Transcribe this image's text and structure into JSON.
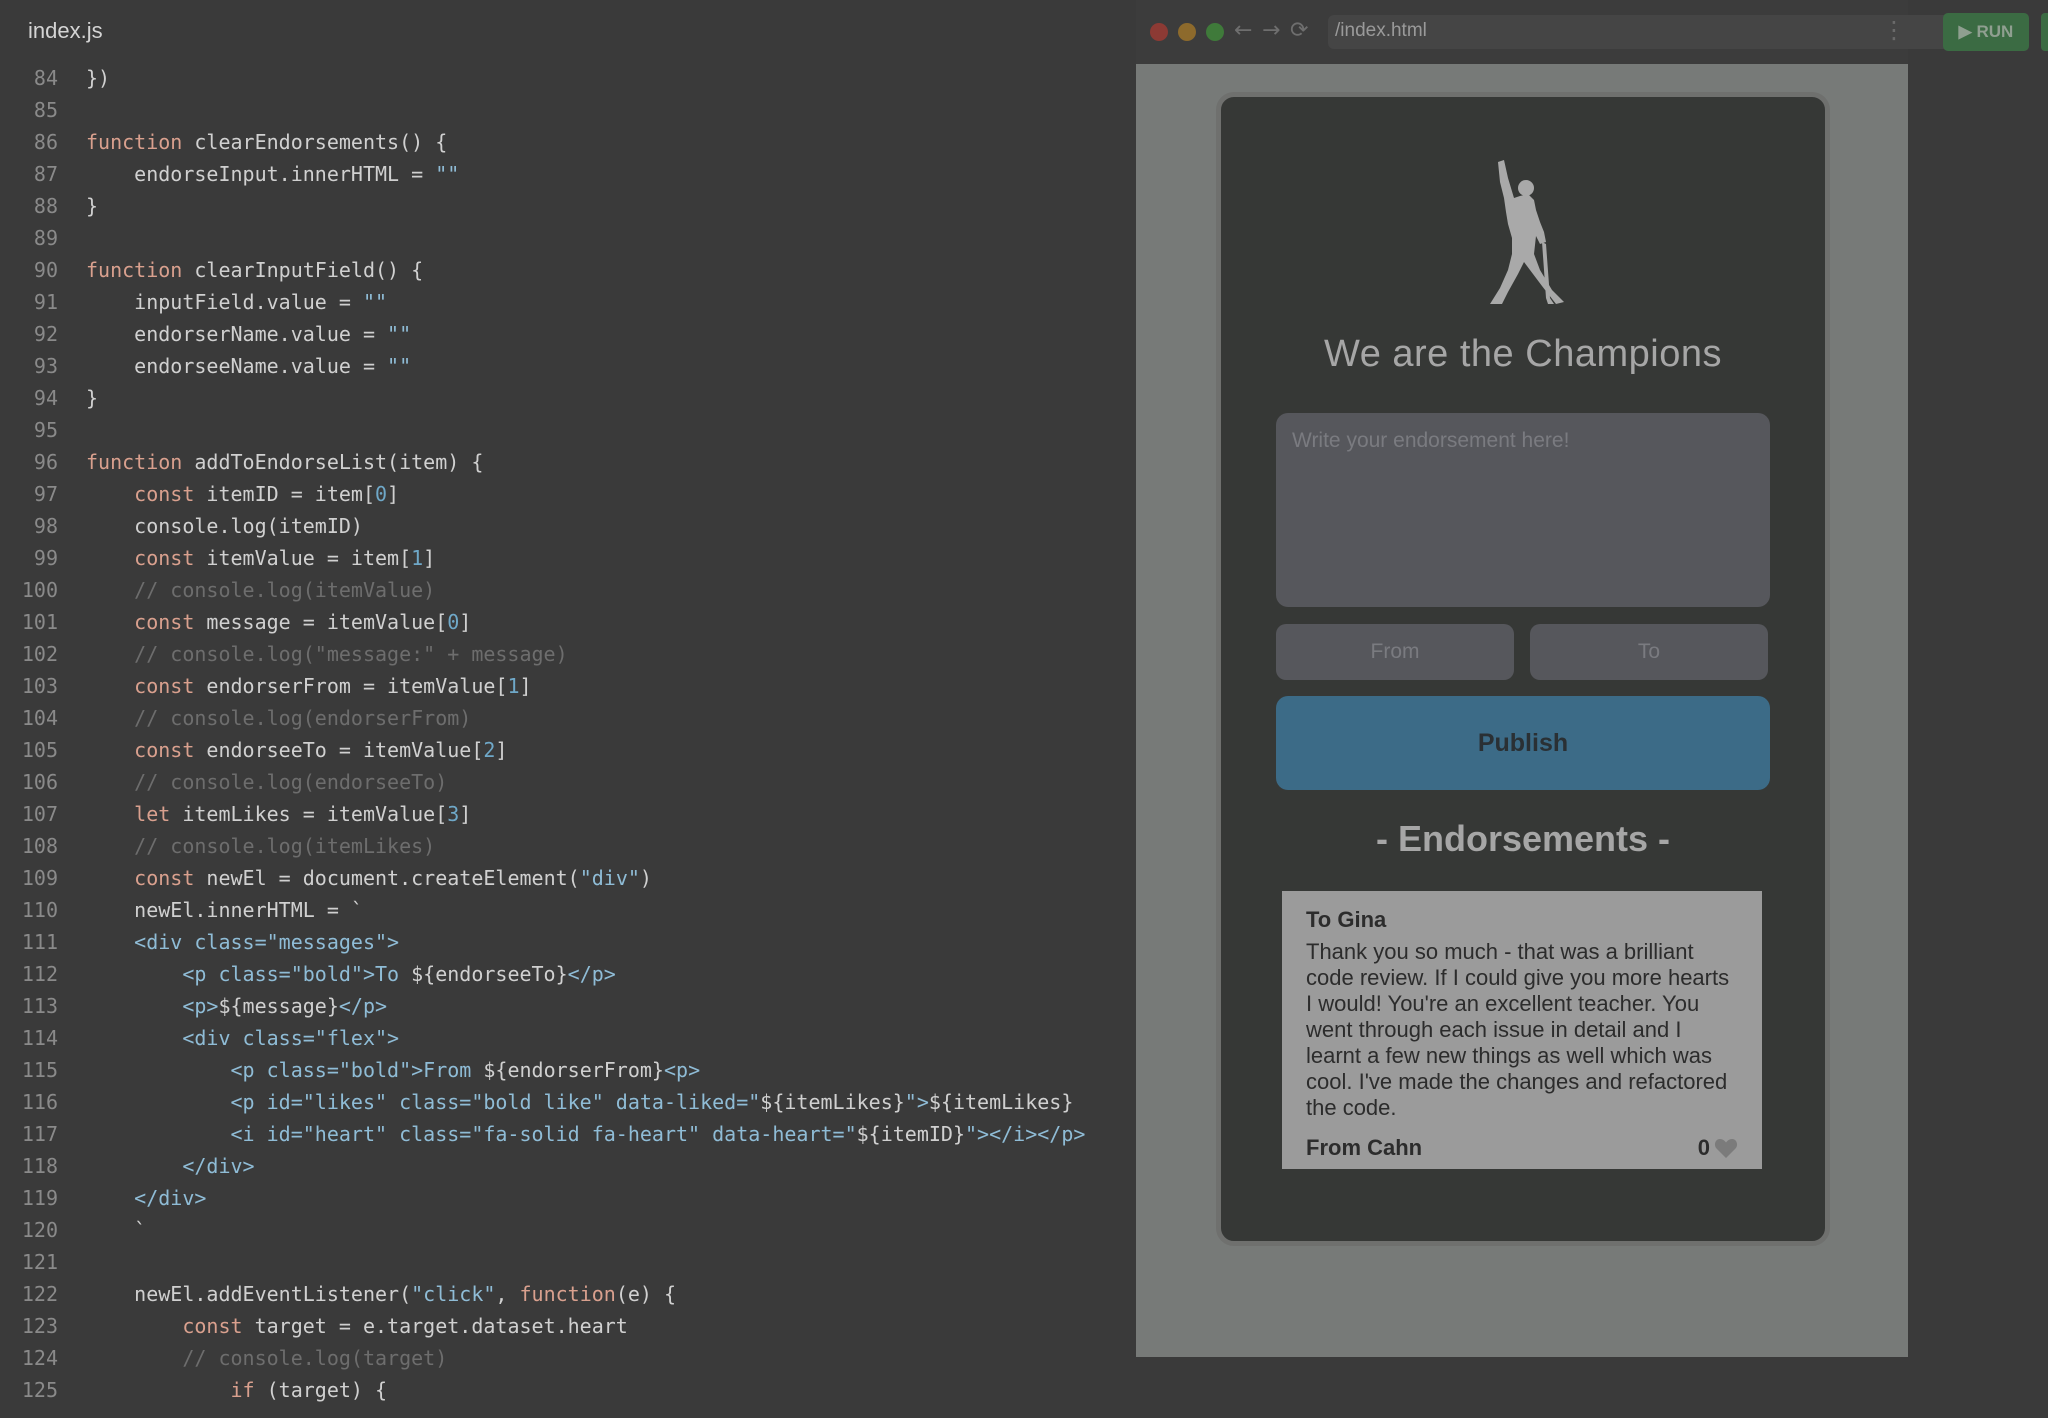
{
  "editor": {
    "tab_title": "index.js",
    "lines": [
      {
        "n": "84",
        "t": [
          [
            "})",
            "pl"
          ]
        ]
      },
      {
        "n": "85",
        "t": []
      },
      {
        "n": "86",
        "t": [
          [
            "function ",
            "kw"
          ],
          [
            "clearEndorsements() {",
            "pl"
          ]
        ]
      },
      {
        "n": "87",
        "t": [
          [
            "    endorseInput.innerHTML = ",
            "pl"
          ],
          [
            "\"\"",
            "str"
          ]
        ]
      },
      {
        "n": "88",
        "t": [
          [
            "}",
            "pl"
          ]
        ]
      },
      {
        "n": "89",
        "t": []
      },
      {
        "n": "90",
        "t": [
          [
            "function ",
            "kw"
          ],
          [
            "clearInputField() {",
            "pl"
          ]
        ]
      },
      {
        "n": "91",
        "t": [
          [
            "    inputField.value = ",
            "pl"
          ],
          [
            "\"\"",
            "str"
          ]
        ]
      },
      {
        "n": "92",
        "t": [
          [
            "    endorserName.value = ",
            "pl"
          ],
          [
            "\"\"",
            "str"
          ]
        ]
      },
      {
        "n": "93",
        "t": [
          [
            "    endorseeName.value = ",
            "pl"
          ],
          [
            "\"\"",
            "str"
          ]
        ]
      },
      {
        "n": "94",
        "t": [
          [
            "}",
            "pl"
          ]
        ]
      },
      {
        "n": "95",
        "t": []
      },
      {
        "n": "96",
        "t": [
          [
            "function ",
            "kw"
          ],
          [
            "addToEndorseList(item) {",
            "pl"
          ]
        ]
      },
      {
        "n": "97",
        "t": [
          [
            "    const ",
            "kw"
          ],
          [
            "itemID = item[",
            "pl"
          ],
          [
            "0",
            "num"
          ],
          [
            "]",
            "pl"
          ]
        ]
      },
      {
        "n": "98",
        "t": [
          [
            "    console.log(itemID)",
            "pl"
          ]
        ]
      },
      {
        "n": "99",
        "t": [
          [
            "    const ",
            "kw"
          ],
          [
            "itemValue = item[",
            "pl"
          ],
          [
            "1",
            "num"
          ],
          [
            "]",
            "pl"
          ]
        ]
      },
      {
        "n": "100",
        "t": [
          [
            "    // console.log(itemValue)",
            "cm"
          ]
        ]
      },
      {
        "n": "101",
        "t": [
          [
            "    const ",
            "kw"
          ],
          [
            "message = itemValue[",
            "pl"
          ],
          [
            "0",
            "num"
          ],
          [
            "]",
            "pl"
          ]
        ]
      },
      {
        "n": "102",
        "t": [
          [
            "    // console.log(\"message:\" + message)",
            "cm"
          ]
        ]
      },
      {
        "n": "103",
        "t": [
          [
            "    const ",
            "kw"
          ],
          [
            "endorserFrom = itemValue[",
            "pl"
          ],
          [
            "1",
            "num"
          ],
          [
            "]",
            "pl"
          ]
        ]
      },
      {
        "n": "104",
        "t": [
          [
            "    // console.log(endorserFrom)",
            "cm"
          ]
        ]
      },
      {
        "n": "105",
        "t": [
          [
            "    const ",
            "kw"
          ],
          [
            "endorseeTo = itemValue[",
            "pl"
          ],
          [
            "2",
            "num"
          ],
          [
            "]",
            "pl"
          ]
        ]
      },
      {
        "n": "106",
        "t": [
          [
            "    // console.log(endorseeTo)",
            "cm"
          ]
        ]
      },
      {
        "n": "107",
        "t": [
          [
            "    let ",
            "kw"
          ],
          [
            "itemLikes = itemValue[",
            "pl"
          ],
          [
            "3",
            "num"
          ],
          [
            "]",
            "pl"
          ]
        ]
      },
      {
        "n": "108",
        "t": [
          [
            "    // console.log(itemLikes)",
            "cm"
          ]
        ]
      },
      {
        "n": "109",
        "t": [
          [
            "    const ",
            "kw"
          ],
          [
            "newEl = document.createElement(",
            "pl"
          ],
          [
            "\"div\"",
            "str"
          ],
          [
            ")",
            "pl"
          ]
        ]
      },
      {
        "n": "110",
        "t": [
          [
            "    newEl.innerHTML = `",
            "pl"
          ]
        ]
      },
      {
        "n": "111",
        "t": [
          [
            "    <div class=\"messages\">",
            "tag"
          ]
        ]
      },
      {
        "n": "112",
        "t": [
          [
            "        <p class=\"bold\">To ",
            "tag"
          ],
          [
            "${endorseeTo}",
            "pl"
          ],
          [
            "</p>",
            "tag"
          ]
        ]
      },
      {
        "n": "113",
        "t": [
          [
            "        <p>",
            "tag"
          ],
          [
            "${message}",
            "pl"
          ],
          [
            "</p>",
            "tag"
          ]
        ]
      },
      {
        "n": "114",
        "t": [
          [
            "        <div class=\"flex\">",
            "tag"
          ]
        ]
      },
      {
        "n": "115",
        "t": [
          [
            "            <p class=\"bold\">From ",
            "tag"
          ],
          [
            "${endorserFrom}",
            "pl"
          ],
          [
            "<p>",
            "tag"
          ]
        ]
      },
      {
        "n": "116",
        "t": [
          [
            "            <p id=\"likes\" class=\"bold like\" data-liked=\"",
            "tag"
          ],
          [
            "${itemLikes}",
            "pl"
          ],
          [
            "\">",
            "tag"
          ],
          [
            "${itemLikes}",
            "pl"
          ]
        ]
      },
      {
        "n": "117",
        "t": [
          [
            "            <i id=\"heart\" class=\"fa-solid fa-heart\" data-heart=\"",
            "tag"
          ],
          [
            "${itemID}",
            "pl"
          ],
          [
            "\"></i></p>",
            "tag"
          ]
        ]
      },
      {
        "n": "118",
        "t": [
          [
            "        </div>",
            "tag"
          ]
        ]
      },
      {
        "n": "119",
        "t": [
          [
            "    </div>",
            "tag"
          ]
        ]
      },
      {
        "n": "120",
        "t": [
          [
            "    `",
            "pl"
          ]
        ]
      },
      {
        "n": "121",
        "t": []
      },
      {
        "n": "122",
        "t": [
          [
            "    newEl.addEventListener(",
            "pl"
          ],
          [
            "\"click\"",
            "str"
          ],
          [
            ", ",
            "pl"
          ],
          [
            "function",
            "kw"
          ],
          [
            "(e) {",
            "pl"
          ]
        ]
      },
      {
        "n": "123",
        "t": [
          [
            "        const ",
            "kw"
          ],
          [
            "target = e.target.dataset.heart",
            "pl"
          ]
        ]
      },
      {
        "n": "124",
        "t": [
          [
            "        // console.log(target)",
            "cm"
          ]
        ]
      },
      {
        "n": "125",
        "t": [
          [
            "            if ",
            "kw"
          ],
          [
            "(target) {",
            "pl"
          ]
        ]
      }
    ]
  },
  "browser": {
    "url": "/index.html",
    "nav_icons": [
      "back-icon",
      "forward-icon",
      "reload-icon",
      "more-vertical-icon"
    ],
    "traffic_colors": [
      "#8c3a34",
      "#8d6a2c",
      "#3f7a3a"
    ]
  },
  "app": {
    "title": "We are the Champions",
    "logo_icon": "champion-silhouette-icon",
    "input_placeholder": "Write your endorsement here!",
    "from_placeholder": "From",
    "to_placeholder": "To",
    "publish_label": "Publish",
    "endorsements_heading": "- Endorsements -",
    "endorsements": [
      {
        "to": "To Gina",
        "message": "Thank you so much - that was a brilliant code review. If I could give you more hearts I would! You're an excellent teacher. You went through each issue in detail and I learnt a few new things as well which was cool. I've made the changes and refactored the code.",
        "from": "From Cahn",
        "likes": "0"
      }
    ]
  },
  "toolbar": {
    "run_label": "RUN"
  }
}
